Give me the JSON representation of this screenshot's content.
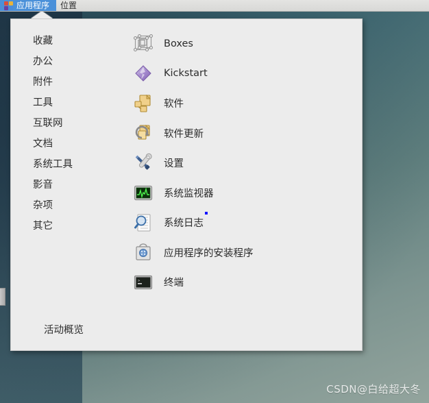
{
  "menubar": {
    "items": [
      {
        "label": "应用程序",
        "icon": "applications-icon",
        "active": true
      },
      {
        "label": "位置",
        "icon": "",
        "active": false
      }
    ]
  },
  "menu": {
    "categories": [
      {
        "label": "收藏"
      },
      {
        "label": "办公"
      },
      {
        "label": "附件"
      },
      {
        "label": "工具"
      },
      {
        "label": "互联网"
      },
      {
        "label": "文档"
      },
      {
        "label": "系统工具"
      },
      {
        "label": "影音"
      },
      {
        "label": "杂项"
      },
      {
        "label": "其它"
      }
    ],
    "applications": [
      {
        "label": "Boxes",
        "icon": "boxes-icon"
      },
      {
        "label": "Kickstart",
        "icon": "kickstart-icon"
      },
      {
        "label": "软件",
        "icon": "software-icon"
      },
      {
        "label": "软件更新",
        "icon": "software-update-icon"
      },
      {
        "label": "设置",
        "icon": "settings-icon"
      },
      {
        "label": "系统监视器",
        "icon": "system-monitor-icon"
      },
      {
        "label": "系统日志",
        "icon": "system-log-icon"
      },
      {
        "label": "应用程序的安装程序",
        "icon": "package-installer-icon"
      },
      {
        "label": "终端",
        "icon": "terminal-icon"
      }
    ],
    "activities_label": "活动概览"
  },
  "watermark": {
    "text": "CSDN@白给超大冬"
  },
  "colors": {
    "accent": "#4a90d9",
    "panel_bg": "#ececec",
    "desktop_teal": "#5f7f7e",
    "desktop_dark": "#2c4656"
  }
}
